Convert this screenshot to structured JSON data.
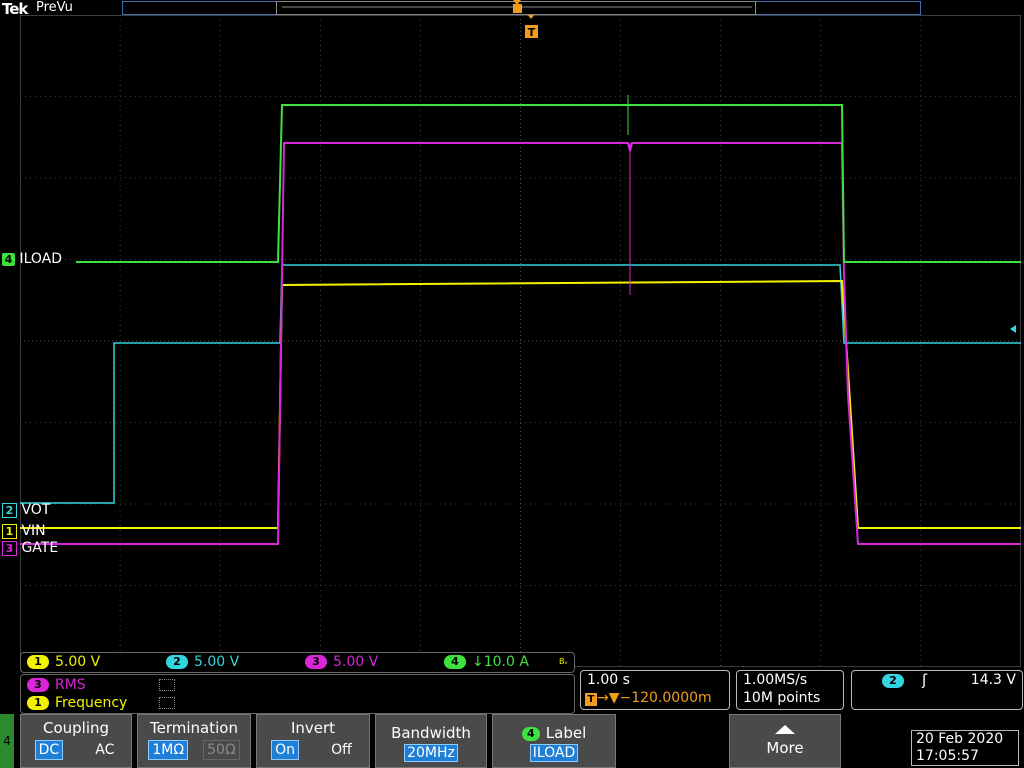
{
  "header": {
    "brand": "Tek",
    "mode": "PreVu"
  },
  "channels": {
    "ch4_label": "ILOAD",
    "ch2_label": "VOT",
    "ch1_label": "VIN",
    "ch3_label": "GATE",
    "ch1_num": "1",
    "ch2_num": "2",
    "ch3_num": "3",
    "ch4_num": "4"
  },
  "readout": {
    "ch1_scale": "5.00 V",
    "ch2_scale": "5.00 V",
    "ch3_scale": "5.00 V",
    "ch4_scale": "↓10.0 A",
    "bw_mark": "Bᵥ"
  },
  "measurements": [
    {
      "ch": "3",
      "name": "RMS"
    },
    {
      "ch": "1",
      "name": "Frequency"
    }
  ],
  "horizontal": {
    "scale": "1.00 s",
    "position": "→▼−120.0000m"
  },
  "acquisition": {
    "rate": "1.00MS/s",
    "points": "10M points"
  },
  "trigger": {
    "source": "2",
    "slope": "ʃ",
    "level": "14.3 V"
  },
  "menu": {
    "side_num": "4",
    "coupling": {
      "title": "Coupling",
      "opt1": "DC",
      "opt2": "AC"
    },
    "termination": {
      "title": "Termination",
      "opt1": "1MΩ",
      "opt2": "50Ω"
    },
    "invert": {
      "title": "Invert",
      "opt1": "On",
      "opt2": "Off"
    },
    "bandwidth": {
      "title": "Bandwidth",
      "value": "20MHz"
    },
    "label": {
      "title": "Label",
      "value": "ILOAD",
      "ch": "4"
    },
    "more": "More"
  },
  "datetime": {
    "date": "20 Feb  2020",
    "time": "17:05:57"
  },
  "colors": {
    "ch1": "#f2f200",
    "ch2": "#33d6e0",
    "ch3": "#d826d8",
    "ch4": "#3ee23e",
    "trigger": "#f39c1c"
  }
}
